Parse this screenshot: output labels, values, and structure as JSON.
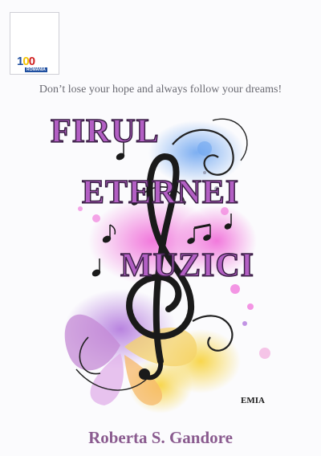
{
  "logo": {
    "digits": [
      "1",
      "0",
      "0"
    ],
    "text": "ROMANIA",
    "colors": {
      "blue": "#1f4fa0",
      "yellow": "#f2c200",
      "red": "#d02020"
    }
  },
  "tagline": "Don’t lose your hope and always follow your dreams!",
  "title": {
    "line1": "FIRUL",
    "line2": "ETERNEI",
    "line3": "MUZICI"
  },
  "publisher": "EMIA",
  "author": "Roberta S. Gandore",
  "colors": {
    "title_fill": "#b35fc4",
    "title_outline": "#3a1f45",
    "author": "#8a5b8f"
  }
}
